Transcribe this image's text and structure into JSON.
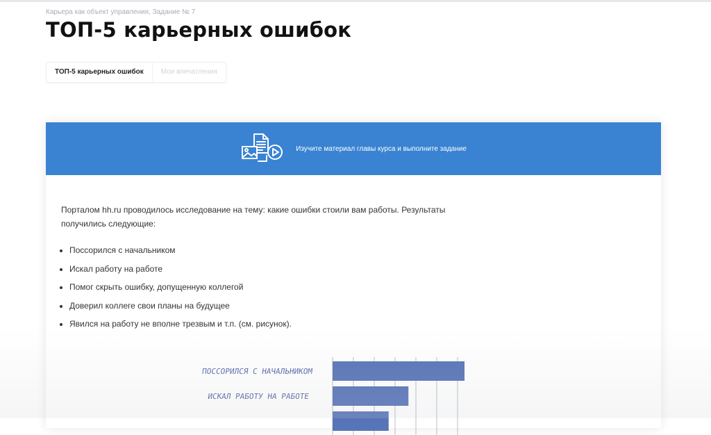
{
  "breadcrumb": "Карьера как объект управления, Задание № 7",
  "page_title": "ТОП-5 карьерных ошибок",
  "tabs": [
    {
      "label": "ТОП-5 карьерных ошибок",
      "active": true
    },
    {
      "label": "Мои впечатления",
      "active": false
    }
  ],
  "banner": {
    "text": "Изучите материал главы курса и выполните задание",
    "color": "#3a83d2",
    "icon": "media-files-icon"
  },
  "content": {
    "intro": "Порталом hh.ru проводилось исследование на тему: какие ошибки стоили вам работы. Результаты получились следующие:",
    "items": [
      "Поссорился с начальником",
      "Искал работу на работе",
      "Помог скрыть ошибку, допущенную коллегой",
      "Доверил коллеге свои планы на будущее",
      "Явился на работу не вполне трезвым и т.п. (см. рисунок)."
    ]
  },
  "chart_data": {
    "type": "bar",
    "orientation": "horizontal",
    "categories": [
      "ПОССОРИЛСЯ С НАЧАЛЬНИКОМ",
      "ИСКАЛ РАБОТУ НА РАБОТЕ",
      ""
    ],
    "values": [
      40,
      23,
      17
    ],
    "xlim": [
      0,
      40
    ],
    "grid": true,
    "bar_color": "#5874b8"
  }
}
